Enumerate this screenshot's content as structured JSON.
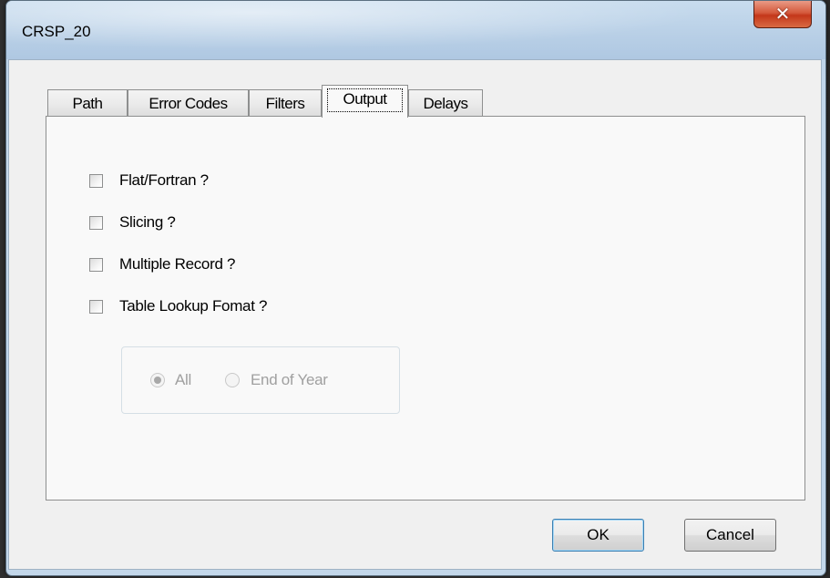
{
  "window": {
    "title": "CRSP_20",
    "close_glyph": "✕"
  },
  "tabs": [
    {
      "label": "Path",
      "active": false
    },
    {
      "label": "Error Codes",
      "active": false
    },
    {
      "label": "Filters",
      "active": false
    },
    {
      "label": "Output",
      "active": true
    },
    {
      "label": "Delays",
      "active": false
    }
  ],
  "output_panel": {
    "checkboxes": [
      {
        "label": "Flat/Fortran ?",
        "checked": false
      },
      {
        "label": "Slicing ?",
        "checked": false
      },
      {
        "label": "Multiple Record ?",
        "checked": false
      },
      {
        "label": "Table Lookup Fomat ?",
        "checked": false
      }
    ],
    "radio_group": {
      "enabled": false,
      "options": [
        {
          "label": "All",
          "selected": true
        },
        {
          "label": "End of Year",
          "selected": false
        }
      ]
    }
  },
  "buttons": {
    "ok_label": "OK",
    "cancel_label": "Cancel"
  }
}
